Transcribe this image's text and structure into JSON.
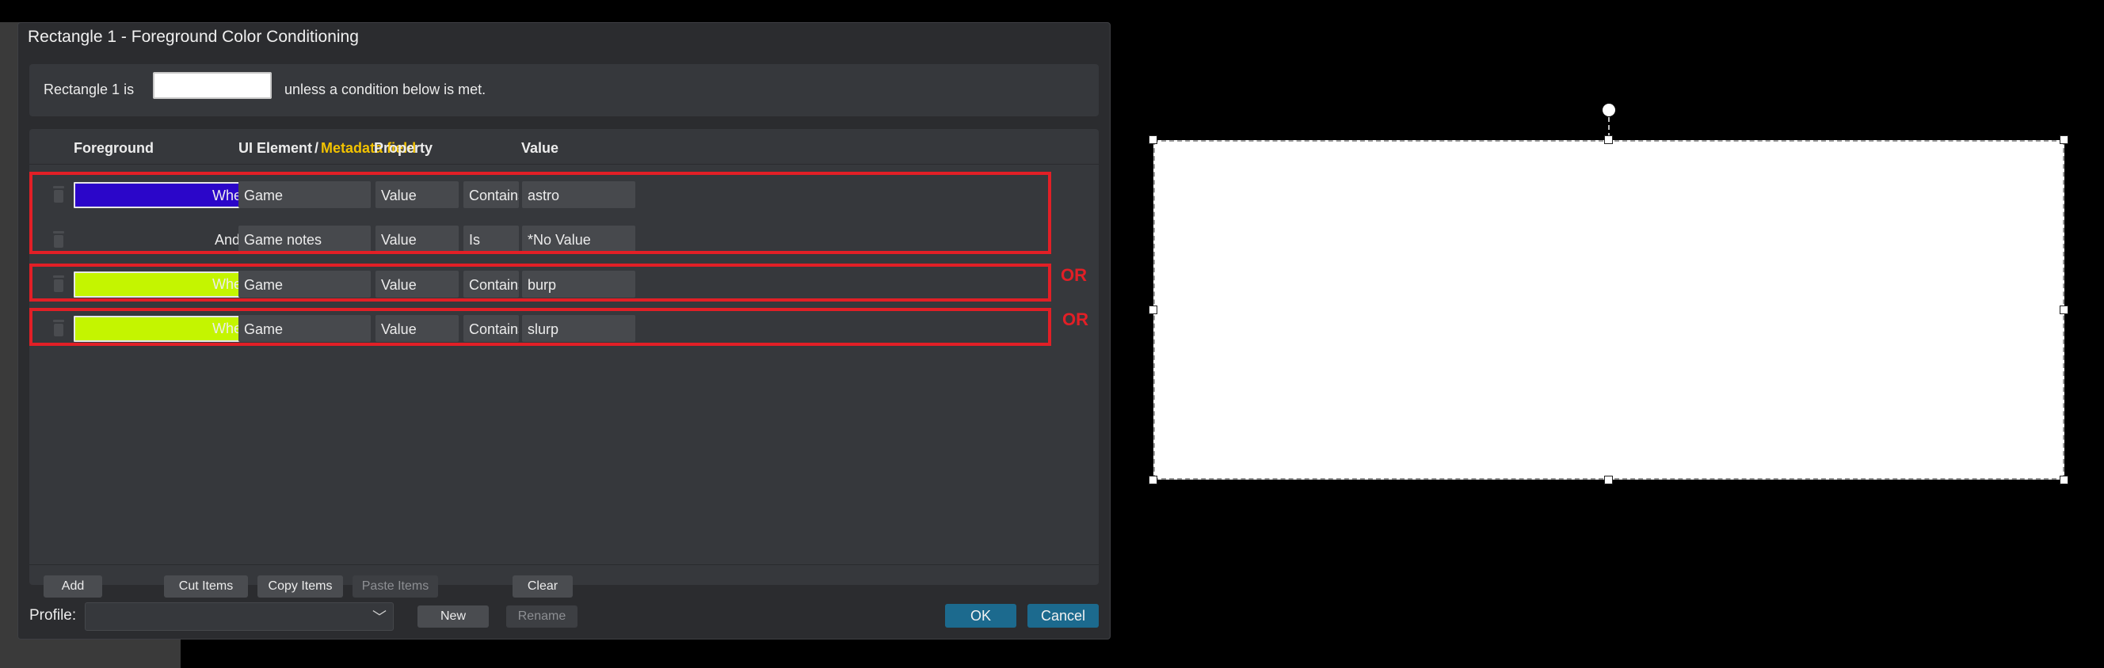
{
  "dialog": {
    "title": "Rectangle 1 - Foreground Color Conditioning",
    "default": {
      "prefix": "Rectangle 1 is",
      "color": "#ffffff",
      "suffix": "unless a condition below is met."
    },
    "headers": {
      "foreground": "Foreground",
      "ui_element": "UI Element",
      "slash": "/",
      "metadata_field": "Metadata field",
      "property": "Property",
      "value": "Value"
    },
    "conditions": [
      {
        "color": "#2b06c9",
        "conj": "When",
        "element": "Game",
        "property": "Value",
        "operator": "Contains",
        "value": "astro"
      },
      {
        "color": "",
        "conj": "And",
        "element": "Game notes",
        "property": "Value",
        "operator": "Is",
        "value": "*No Value"
      },
      {
        "color": "#c4f500",
        "conj": "When",
        "element": "Game",
        "property": "Value",
        "operator": "Contains",
        "value": "burp"
      },
      {
        "color": "#c4f500",
        "conj": "When",
        "element": "Game",
        "property": "Value",
        "operator": "Contains",
        "value": "slurp"
      }
    ],
    "annotations": {
      "or_1": "OR",
      "or_2": "OR"
    },
    "buttons": {
      "add": "Add",
      "cut": "Cut Items",
      "copy": "Copy Items",
      "paste": "Paste Items",
      "clear": "Clear",
      "new": "New",
      "rename": "Rename",
      "ok": "OK",
      "cancel": "Cancel"
    },
    "profile": {
      "label": "Profile:",
      "selected": "",
      "chevron": "﹀"
    }
  },
  "colors": {
    "annotation_red": "#e21f26",
    "metadata_gold": "#f2c200",
    "primary_button": "#1c6a8e"
  }
}
